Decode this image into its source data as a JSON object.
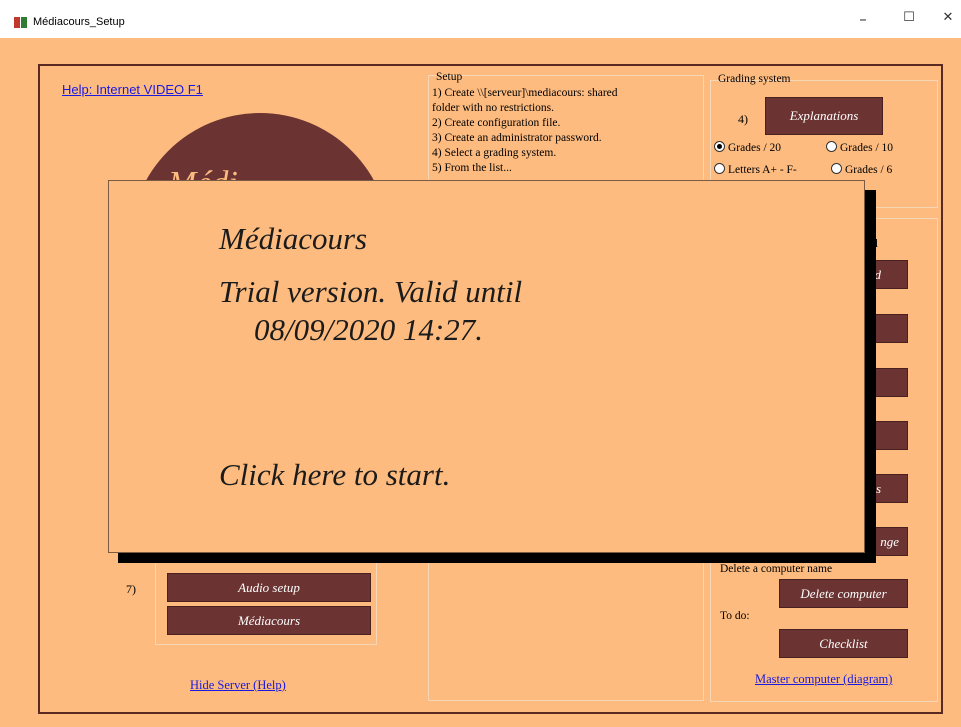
{
  "window": {
    "title": "Médiacours_Setup",
    "minimize": "–",
    "maximize": "☐",
    "close": "✕"
  },
  "help_link": "Help: Internet VIDEO F1",
  "logo_text": "Médi",
  "setup": {
    "title": "Setup",
    "lines": [
      "1) Create \\\\[serveur]\\mediacours: shared",
      "folder with no restrictions.",
      "2) Create configuration file.",
      "3) Create an administrator password.",
      "4) Select a grading system.",
      "5) From the list..."
    ]
  },
  "grading": {
    "title": "Grading system",
    "step": "4)",
    "explanations": "Explanations",
    "options": [
      {
        "label": "Grades / 20",
        "selected": true
      },
      {
        "label": "Grades / 10",
        "selected": false
      },
      {
        "label": "Letters A+ - F-",
        "selected": false
      },
      {
        "label": "Grades / 6",
        "selected": false
      }
    ]
  },
  "right_panel": {
    "partial_label": "d",
    "button_fragments": [
      "d",
      "",
      "",
      "",
      "s",
      "nge"
    ],
    "delete_label": "Delete a computer name",
    "delete_button": "Delete computer",
    "todo_label": "To do:",
    "checklist_button": "Checklist",
    "master_link": "Master computer (diagram)"
  },
  "left_panel": {
    "step7": "7)",
    "audio_button": "Audio setup",
    "mediacours_button": "Médiacours",
    "hide_server_link": "Hide Server (Help)"
  },
  "dialog": {
    "app_name": "Médiacours",
    "trial_line1": "Trial version. Valid until",
    "trial_line2": "08/09/2020 14:27.",
    "start": "Click here to start."
  },
  "colors": {
    "background": "#fdbb7f",
    "button": "#6b3433",
    "link": "#1a1ae0"
  }
}
